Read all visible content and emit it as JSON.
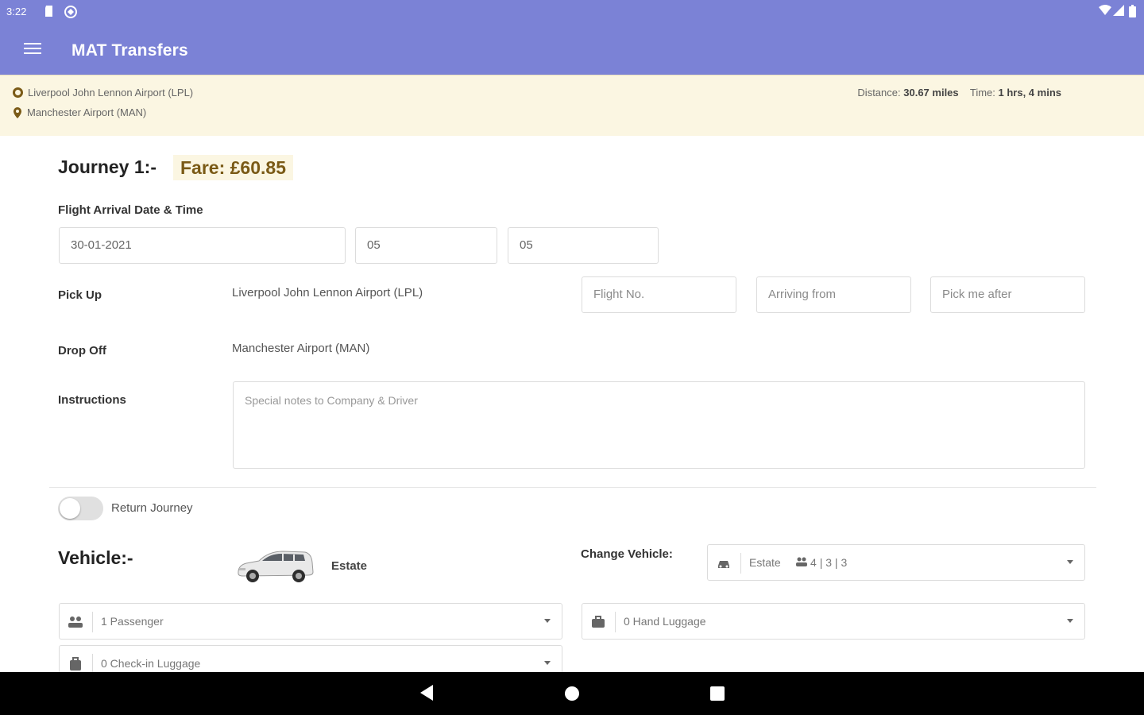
{
  "status_bar": {
    "time": "3:22"
  },
  "app_bar": {
    "title": "MAT Transfers"
  },
  "route": {
    "origin": "Liverpool John Lennon Airport (LPL)",
    "destination": "Manchester Airport (MAN)",
    "distance_label": "Distance:",
    "distance_value": "30.67 miles",
    "time_label": "Time:",
    "time_value": "1 hrs, 4 mins"
  },
  "journey": {
    "title": "Journey 1:-",
    "fare": "Fare: £60.85",
    "flight_arrival_label": "Flight Arrival Date & Time",
    "date_value": "30-01-2021",
    "hour_value": "05",
    "minute_value": "05",
    "pickup_label": "Pick Up",
    "pickup_value": "Liverpool John Lennon Airport (LPL)",
    "flight_no_placeholder": "Flight No.",
    "arriving_from_placeholder": "Arriving from",
    "pick_me_after_placeholder": "Pick me after",
    "dropoff_label": "Drop Off",
    "dropoff_value": "Manchester Airport (MAN)",
    "instructions_label": "Instructions",
    "instructions_placeholder": "Special notes to Company & Driver"
  },
  "return_journey": {
    "label": "Return Journey",
    "enabled": false
  },
  "vehicle": {
    "title": "Vehicle:-",
    "name": "Estate",
    "change_label": "Change Vehicle:",
    "select_name": "Estate",
    "capacity": "4 | 3 | 3",
    "passengers": "1 Passenger",
    "hand_luggage": "0 Hand Luggage",
    "checkin_luggage": "0 Check-in Luggage"
  },
  "colors": {
    "primary": "#7b82d6",
    "banner": "#fbf6e2",
    "fare_text": "#7a5a16"
  }
}
